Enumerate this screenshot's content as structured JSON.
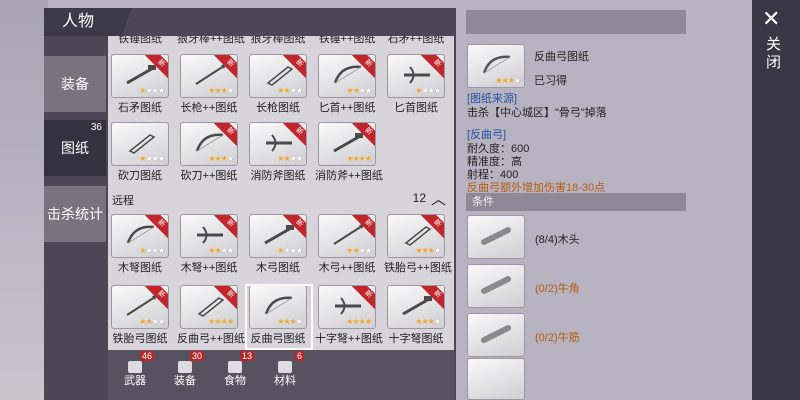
{
  "header": {
    "title": "人物"
  },
  "side_tabs": [
    {
      "label": "装备",
      "badge": ""
    },
    {
      "label": "图纸",
      "badge": "36"
    },
    {
      "label": "击杀统计",
      "badge": ""
    }
  ],
  "grid": {
    "top_partial": [
      "铁锤图纸",
      "狼牙棒++图纸",
      "狼牙棒图纸",
      "铁锤++图纸",
      "石矛++图纸"
    ],
    "row1": [
      {
        "label": "石矛图纸",
        "stars": 1,
        "new": true
      },
      {
        "label": "长枪++图纸",
        "stars": 3,
        "new": true
      },
      {
        "label": "长枪图纸",
        "stars": 2,
        "new": true
      },
      {
        "label": "匕首++图纸",
        "stars": 2,
        "new": true
      },
      {
        "label": "匕首图纸",
        "stars": 1,
        "new": true
      }
    ],
    "row2": [
      {
        "label": "砍刀图纸",
        "stars": 1,
        "new": false
      },
      {
        "label": "砍刀++图纸",
        "stars": 3,
        "new": true
      },
      {
        "label": "消防斧图纸",
        "stars": 2,
        "new": true
      },
      {
        "label": "消防斧++图纸",
        "stars": 4,
        "new": true
      }
    ],
    "ranged_section": {
      "title": "远程",
      "count": "12"
    },
    "row3": [
      {
        "label": "木弩图纸",
        "stars": 1,
        "new": true
      },
      {
        "label": "木弩++图纸",
        "stars": 2,
        "new": true
      },
      {
        "label": "木弓图纸",
        "stars": 1,
        "new": true
      },
      {
        "label": "木弓++图纸",
        "stars": 2,
        "new": true
      },
      {
        "label": "铁胎弓++图纸",
        "stars": 3,
        "new": true
      }
    ],
    "row4": [
      {
        "label": "铁胎弓图纸",
        "stars": 2,
        "new": true
      },
      {
        "label": "反曲弓++图纸",
        "stars": 4,
        "new": true
      },
      {
        "label": "反曲弓图纸",
        "stars": 3,
        "new": false
      },
      {
        "label": "十字弩++图纸",
        "stars": 4,
        "new": true
      },
      {
        "label": "十字弩图纸",
        "stars": 3,
        "new": true
      }
    ],
    "new_badge": "新"
  },
  "bottom_tabs": [
    {
      "label": "武器",
      "count": "46",
      "icon": "sword-icon"
    },
    {
      "label": "装备",
      "count": "30",
      "icon": "shirt-icon"
    },
    {
      "label": "食物",
      "count": "13",
      "icon": "bowl-icon"
    },
    {
      "label": "材料",
      "count": "6",
      "icon": "log-icon"
    }
  ],
  "detail": {
    "name": "反曲弓图纸",
    "status": "已习得",
    "source_label": "[图纸来源]",
    "source_text": "击杀【中心城区】\"骨弓\"掉落",
    "item_label": "[反曲弓]",
    "stats": [
      "耐久度：600",
      "精准度：高",
      "射程：400"
    ],
    "bonus": "反曲弓额外增加伤害18-30点",
    "stars": 3,
    "conditions_title": "条件",
    "materials": [
      {
        "text": "(8/4)木头",
        "sufficient": true,
        "icon": "log-icon"
      },
      {
        "text": "(0/2)牛角",
        "sufficient": false,
        "icon": "horn-icon"
      },
      {
        "text": "(0/2)牛筋",
        "sufficient": false,
        "icon": "sinew-icon"
      }
    ]
  },
  "close": {
    "label": "关闭"
  },
  "colors": {
    "accent_new": "#c0262b",
    "star": "#f2a928",
    "source_blue": "#2352a8",
    "warn_orange": "#b45c12"
  }
}
